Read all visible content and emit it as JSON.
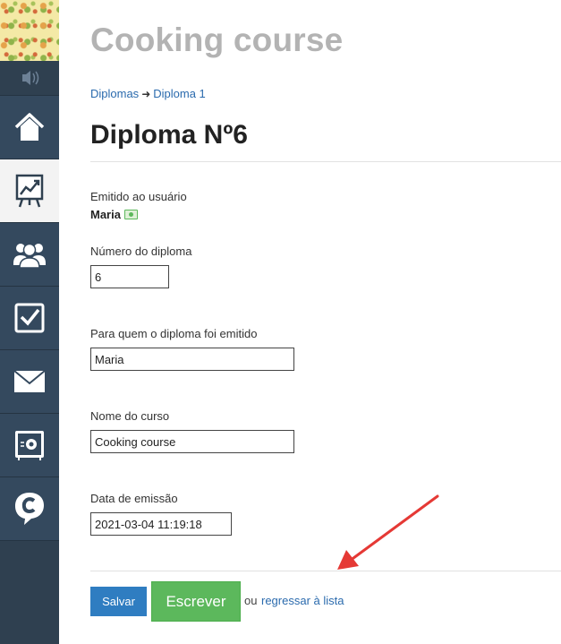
{
  "header": {
    "course_title": "Cooking course"
  },
  "breadcrumb": {
    "root": "Diplomas",
    "separator": "➜",
    "current": "Diploma 1"
  },
  "page": {
    "title": "Diploma Nº6"
  },
  "issued": {
    "label": "Emitido ao usuário",
    "user": "Maria"
  },
  "form": {
    "number_label": "Número do diploma",
    "number_value": "6",
    "recipient_label": "Para quem o diploma foi emitido",
    "recipient_value": "Maria",
    "course_label": "Nome do curso",
    "course_value": "Cooking course",
    "date_label": "Data de emissão",
    "date_value": "2021-03-04 11:19:18"
  },
  "actions": {
    "save_label": "Salvar",
    "write_label": "Escrever",
    "or_text": "ou",
    "back_link": "regressar à lista"
  },
  "sidebar": {
    "items": [
      {
        "icon": "home-icon"
      },
      {
        "icon": "chart-board-icon",
        "active": true
      },
      {
        "icon": "users-icon"
      },
      {
        "icon": "checkbox-icon"
      },
      {
        "icon": "mail-icon"
      },
      {
        "icon": "safe-icon"
      },
      {
        "icon": "chat-c-icon"
      }
    ]
  },
  "colors": {
    "sidebar_bg": "#2f4050",
    "link": "#2a6aad",
    "save_button": "#2f7dc1",
    "write_button": "#5cb85c",
    "annotation_arrow": "#e53935"
  }
}
